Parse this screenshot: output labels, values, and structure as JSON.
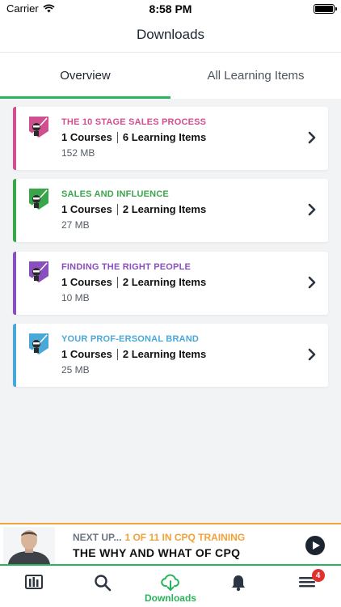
{
  "status_bar": {
    "carrier": "Carrier",
    "time": "8:58 PM"
  },
  "header": {
    "title": "Downloads"
  },
  "tabs": [
    {
      "label": "Overview",
      "active": true
    },
    {
      "label": "All Learning Items",
      "active": false
    }
  ],
  "cards": [
    {
      "title": "THE 10 STAGE SALES PROCESS",
      "courses": "1 Courses",
      "items": "6 Learning Items",
      "size": "152 MB",
      "color": "#d04f8f"
    },
    {
      "title": "SALES AND INFLUENCE",
      "courses": "1 Courses",
      "items": "2 Learning Items",
      "size": "27 MB",
      "color": "#3aa64c"
    },
    {
      "title": "FINDING THE RIGHT PEOPLE",
      "courses": "1 Courses",
      "items": "2 Learning Items",
      "size": "10 MB",
      "color": "#8a4fbf"
    },
    {
      "title": "YOUR PROF-ERSONAL BRAND",
      "courses": "1 Courses",
      "items": "2 Learning Items",
      "size": "25 MB",
      "color": "#4aa8d8"
    }
  ],
  "next_up": {
    "label": "NEXT UP...",
    "series": "1 OF 11 IN CPQ TRAINING",
    "title": "THE WHY AND WHAT OF CPQ"
  },
  "tabbar": {
    "items": [
      {
        "icon": "library-icon"
      },
      {
        "icon": "search-icon"
      },
      {
        "icon": "download-cloud-icon",
        "label": "Downloads"
      },
      {
        "icon": "bell-icon"
      },
      {
        "icon": "menu-icon",
        "badge": "4"
      }
    ]
  }
}
